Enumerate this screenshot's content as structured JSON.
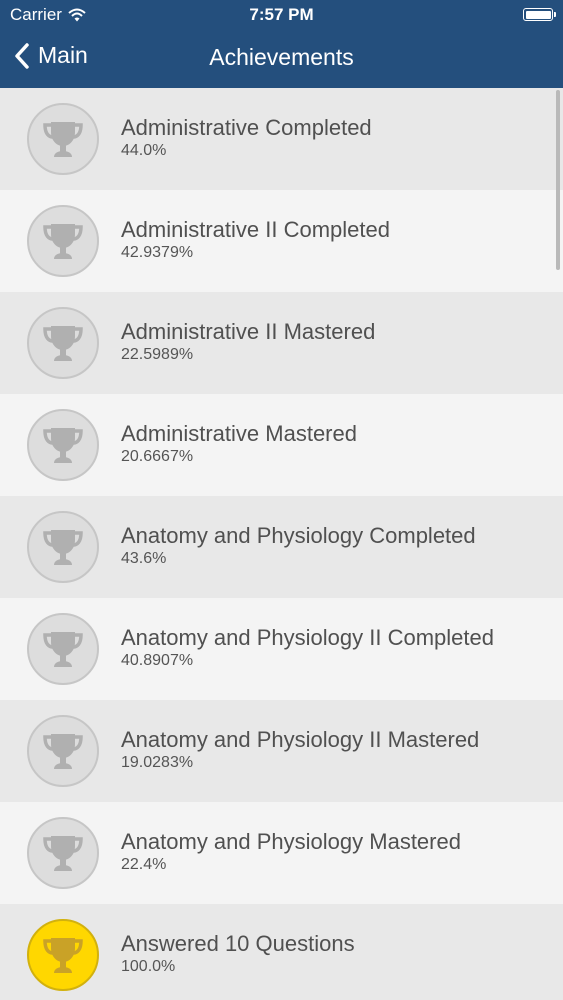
{
  "status_bar": {
    "carrier": "Carrier",
    "time": "7:57 PM"
  },
  "nav": {
    "back_label": "Main",
    "title": "Achievements"
  },
  "colors": {
    "header": "#244f7d",
    "earned_badge": "#ffd700",
    "locked_badge": "#dddddd"
  },
  "achievements": [
    {
      "title": "Administrative Completed",
      "percent": "44.0%",
      "earned": false
    },
    {
      "title": "Administrative II Completed",
      "percent": "42.9379%",
      "earned": false
    },
    {
      "title": "Administrative II Mastered",
      "percent": "22.5989%",
      "earned": false
    },
    {
      "title": "Administrative Mastered",
      "percent": "20.6667%",
      "earned": false
    },
    {
      "title": "Anatomy and Physiology Completed",
      "percent": "43.6%",
      "earned": false
    },
    {
      "title": "Anatomy and Physiology II Completed",
      "percent": "40.8907%",
      "earned": false
    },
    {
      "title": "Anatomy and Physiology II Mastered",
      "percent": "19.0283%",
      "earned": false
    },
    {
      "title": "Anatomy and Physiology Mastered",
      "percent": "22.4%",
      "earned": false
    },
    {
      "title": "Answered 10 Questions",
      "percent": "100.0%",
      "earned": true
    }
  ],
  "icons": {
    "achievement": "trophy-icon",
    "back": "chevron-left-icon",
    "wifi": "wifi-icon",
    "battery": "battery-icon"
  }
}
